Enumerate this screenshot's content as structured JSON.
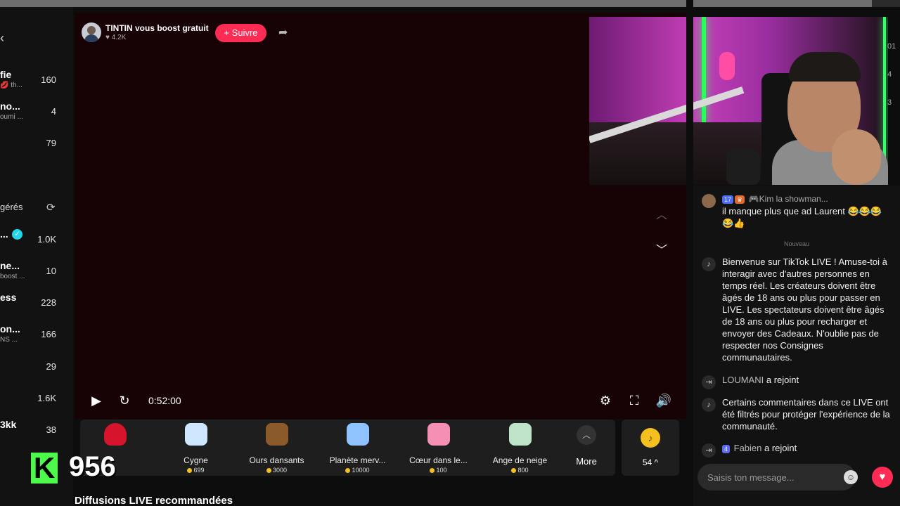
{
  "sidebar": {
    "back_icon": "chevron-left-icon",
    "section_label": "gérés",
    "refresh_icon": "refresh-icon",
    "items_top": [
      {
        "name": "fie",
        "sub": "💋 th...",
        "count": "160"
      },
      {
        "name": "no...",
        "sub": "oumi ...",
        "count": "4"
      },
      {
        "name": "",
        "sub": "",
        "count": "79"
      }
    ],
    "items_bottom": [
      {
        "name": "...",
        "sub": "",
        "count": "1.0K",
        "verified": true
      },
      {
        "name": "ne...",
        "sub": "boost ...",
        "count": "10"
      },
      {
        "name": "ess",
        "sub": "",
        "count": "228"
      },
      {
        "name": "on...",
        "sub": "NS ...",
        "count": "166"
      },
      {
        "name": "",
        "sub": "",
        "count": "29"
      },
      {
        "name": "",
        "sub": "",
        "count": "1.6K"
      },
      {
        "name": "3kk",
        "sub": "",
        "count": "38"
      }
    ]
  },
  "host": {
    "name": "TINTIN vous boost gratuit",
    "likes": "♥ 4.2K",
    "follow_label": "+ Suivre"
  },
  "player": {
    "timecode": "0:52:00"
  },
  "gifts": [
    {
      "name": "",
      "price": "",
      "color": "#d6142c"
    },
    {
      "name": "Cygne",
      "price": "699",
      "color": "#cfe6ff"
    },
    {
      "name": "Ours dansants",
      "price": "3000",
      "color": "#8b5a2b"
    },
    {
      "name": "Planète merv...",
      "price": "10000",
      "color": "#8fc3ff"
    },
    {
      "name": "Cœur dans le...",
      "price": "100",
      "color": "#f58fb4"
    },
    {
      "name": "Ange de neige",
      "price": "800",
      "color": "#bfe3c9"
    }
  ],
  "more_label": "More",
  "coins": {
    "value": "54 ^"
  },
  "recommended_title": "Diffusions LIVE recommandées",
  "overlay": {
    "k_letter": "K",
    "k_count": "956"
  },
  "right_strip": [
    "01",
    "4",
    "3"
  ],
  "chat": {
    "first": {
      "badges": [
        "17",
        "♛"
      ],
      "user": "🎮Kim la showman...",
      "text": "il manque plus que ad Laurent 😂😂😂😂👍"
    },
    "divider": "Nouveau",
    "welcome": "Bienvenue sur TikTok LIVE ! Amuse-toi à interagir avec d'autres personnes en temps réel. Les créateurs doivent être âgés de 18 ans ou plus pour passer en LIVE. Les spectateurs doivent être âgés de 18 ans ou plus pour recharger et envoyer des Cadeaux. N'oublie pas de respecter nos Consignes communautaires.",
    "joined1": {
      "user": "LOUMANI",
      "action": "a rejoint"
    },
    "filtered": "Certains commentaires dans ce LIVE ont été filtrés pour protéger l'expérience de la communauté.",
    "joined2": {
      "badge": "4",
      "user": "Fabien",
      "action": "a rejoint"
    },
    "input_placeholder": "Saisis ton message..."
  },
  "colors": {
    "accent": "#fe2c55",
    "coin": "#f4c01f",
    "badge_green": "#4cf84a"
  }
}
